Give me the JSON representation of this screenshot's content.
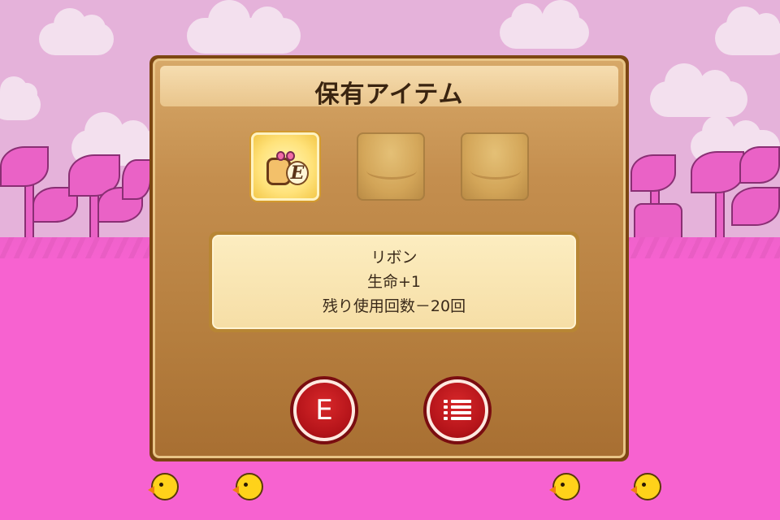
{
  "dialog": {
    "title": "保有アイテム",
    "slots": [
      {
        "state": "equipped",
        "icon": "ribbon-icon",
        "equip_mark": "E"
      },
      {
        "state": "empty",
        "icon": ""
      },
      {
        "state": "empty",
        "icon": ""
      }
    ],
    "info": {
      "name": "リボン",
      "effect": "生命+1",
      "remaining": "残り使用回数－20回"
    },
    "buttons": {
      "equip_label": "E",
      "list_icon": "list-icon"
    }
  },
  "colors": {
    "sky": "#e5b2da",
    "ground": "#f762d0",
    "dialog_border": "#7c4612",
    "button_red": "#b5141a"
  }
}
